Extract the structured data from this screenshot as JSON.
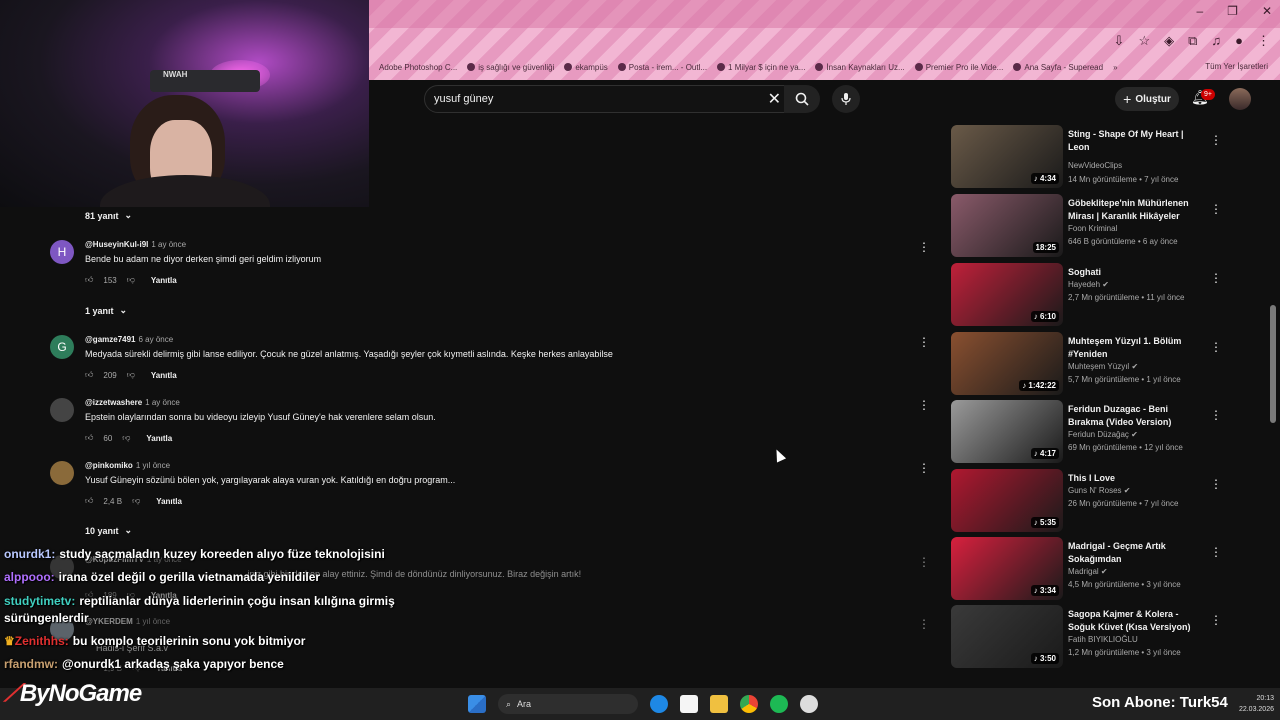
{
  "browser": {
    "bookmarks": [
      "Adobe Photoshop C...",
      "iş sağlığı ve güvenliği",
      "ekampüs",
      "Posta - irem... - Outl...",
      "1 Milyar $ için ne ya...",
      "İnsan Kaynakları Uz...",
      "Premier Pro ile Vide...",
      "Ana Sayfa - Superead"
    ],
    "bookmarks_more": "»",
    "all_bookmarks": "Tüm Yer İşaretleri",
    "window_controls": [
      "–",
      "❐",
      "✕"
    ]
  },
  "webcam": {
    "logo_text": "NWAH"
  },
  "youtube": {
    "search_query": "yusuf güney",
    "create_label": "Oluştur",
    "notification_count": "9+"
  },
  "comments": {
    "toggles": [
      "81 yanıt",
      "1 yanıt",
      "10 yanıt"
    ],
    "reply_label": "Yanıtla",
    "items": [
      {
        "author": "@HuseyinKul-i9l",
        "date": "1 ay önce",
        "text": "Bende bu adam ne diyor derken şimdi geri geldim izliyorum",
        "likes": "153",
        "avatar_letter": "H",
        "avatar_color": "#7e57c2"
      },
      {
        "author": "@gamze7491",
        "date": "6 ay önce",
        "text": "Medyada sürekli delirmiş gibi lanse ediliyor. Çocuk ne güzel anlatmış. Yaşadığı şeyler çok kıymetli aslında. Keşke herkes anlayabilse",
        "likes": "209",
        "avatar_letter": "G",
        "avatar_color": "#2e7d5b"
      },
      {
        "author": "@izzetwashere",
        "date": "1 ay önce",
        "text": "Epstein olaylarından sonra bu videoyu izleyip Yusuf Güney'e hak verenlere selam olsun.",
        "likes": "60",
        "avatar_letter": "",
        "avatar_color": "#444444"
      },
      {
        "author": "@pinkomiko",
        "date": "1 yıl önce",
        "text": "Yusuf Güneyin sözünü bölen yok, yargılayarak alaya vuran yok. Katıldığı en doğru program...",
        "likes": "2,4 B",
        "avatar_letter": "",
        "avatar_color": "#8a6a3a"
      },
      {
        "author": "@KopuzFilmTV",
        "date": "1 ay önce",
        "text": "...iniz gibi bir de hep alay ettiniz. Şimdi de döndünüz dinliyorsunuz. Biraz değişin artık!",
        "likes": "189",
        "avatar_letter": "",
        "avatar_color": "#555555"
      },
      {
        "author": "@YKERDEM",
        "date": "1 yıl önce",
        "text": "Hadis-i Şerif S.a.v",
        "likes": "1,9 B",
        "avatar_letter": "",
        "avatar_color": "#9aa8b5"
      }
    ]
  },
  "sidebar": {
    "videos": [
      {
        "title": "Sting - Shape Of My Heart | Leon",
        "channel": "NewVideoClips",
        "verified": false,
        "meta": "14 Mn görüntüleme • 7 yıl önce",
        "duration": "4:34",
        "color": "#6a5a48"
      },
      {
        "title": "Göbeklitepe'nin Mühürlenen Mirası | Karanlık Hikâyeler",
        "channel": "Foon Kriminal",
        "verified": false,
        "meta": "646 B görüntüleme • 6 ay önce",
        "duration": "18:25",
        "color": "#8a5a6a"
      },
      {
        "title": "Soghati",
        "channel": "Hayedeh",
        "verified": true,
        "meta": "2,7 Mn görüntüleme • 11 yıl önce",
        "duration": "6:10",
        "color": "#c0203a"
      },
      {
        "title": "Muhteşem Yüzyıl 1. Bölüm #Yeniden",
        "channel": "Muhteşem Yüzyıl",
        "verified": true,
        "meta": "5,7 Mn görüntüleme • 1 yıl önce",
        "duration": "1:42:22",
        "color": "#8a5030"
      },
      {
        "title": "Feridun Duzagac - Beni Bırakma (Video Version)",
        "channel": "Feridun Düzağaç",
        "verified": true,
        "meta": "69 Mn görüntüleme • 12 yıl önce",
        "duration": "4:17",
        "color": "#9a9a9a"
      },
      {
        "title": "This I Love",
        "channel": "Guns N' Roses",
        "verified": true,
        "meta": "26 Mn görüntüleme • 7 yıl önce",
        "duration": "5:35",
        "color": "#b01830"
      },
      {
        "title": "Madrigal - Geçme Artık Sokağımdan",
        "channel": "Madrigal",
        "verified": true,
        "meta": "4,5 Mn görüntüleme • 3 yıl önce",
        "duration": "3:34",
        "color": "#d8203e"
      },
      {
        "title": "Sagopa Kajmer & Kolera - Soğuk Küvet  (Kısa Versiyon)",
        "channel": "Fatih BIYIKLIOĞLU",
        "verified": false,
        "meta": "1,2 Mn görüntüleme • 3 yıl önce",
        "duration": "3:50",
        "color": "#3a3a3a"
      }
    ]
  },
  "chat": [
    {
      "user": "onurdk1:",
      "text": "study saçmaladın kuzey koreeden alıyo füze teknolojisini",
      "color": "#b9c8ff"
    },
    {
      "user": "alppooo:",
      "text": "irana özel değil o gerilla vietnamada yenildiler",
      "color": "#b070ff"
    },
    {
      "user": "studytimetv:",
      "text": "reptilianlar dünya liderlerinin çoğu insan kılığına girmiş sürüngenlerdir",
      "color": "#40d0c0"
    },
    {
      "user": "Zenithhs:",
      "text": "bu komplo teorilerinin sonu yok bitmiyor",
      "color": "#e03030"
    },
    {
      "user": "rfandmw:",
      "text": "@onurdk1 arkadaş şaka yapıyor bence",
      "color": "#c8a070"
    }
  ],
  "overlay": {
    "brand": "ByNoGame",
    "subscriber_text": "Son Abone: Turk54",
    "cursor": true
  },
  "taskbar": {
    "search_label": "Ara",
    "time": "20:13",
    "date": "22.03.2026"
  }
}
